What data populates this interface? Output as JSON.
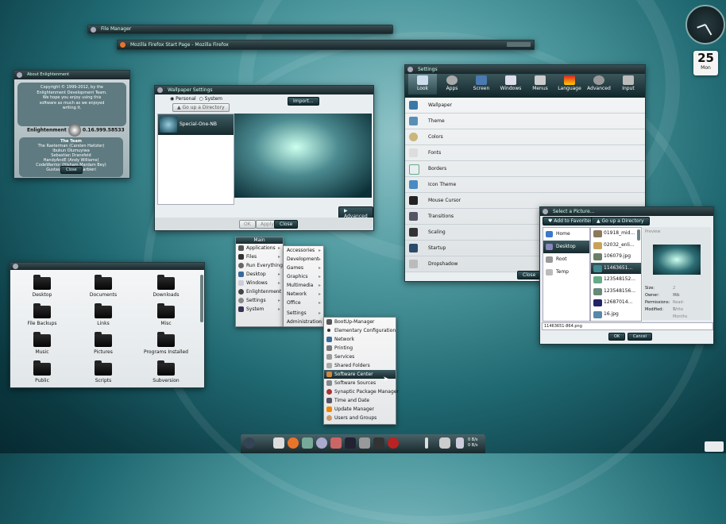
{
  "about": {
    "title": "About Enlightenment",
    "copyright": [
      "Copyright © 1999-2012, by the",
      "Enlightenment Development Team.",
      "",
      "We hope you enjoy using this",
      "software as much as we enjoyed",
      "writing it."
    ],
    "version_label": "Enlightenment",
    "version": "0.16.999.58533",
    "team_title": "The Team",
    "team": [
      "The Rasterman (Carsten Haitzler)",
      "Ibukun Olumuyiwa",
      "Sebastian Dransfeld",
      "HandyAndE (Andy Williams)",
      "CodeWarrior (Hisham Mardam Bey)",
      "Gustavo Sverzut Barbieri"
    ],
    "close_label": "Close"
  },
  "bar1": {
    "title": "File Manager"
  },
  "firefox": {
    "title": "Mozilla Firefox Start Page - Mozilla Firefox"
  },
  "wallpaper": {
    "title": "Wallpaper Settings",
    "personal": "Personal",
    "system": "System",
    "up_dir": "Go up a Directory",
    "import": "Import...",
    "item": "Special-One-NB",
    "advanced": "Advanced",
    "ok": "OK",
    "apply": "Apply",
    "close": "Close"
  },
  "settings": {
    "title": "Settings",
    "tabs": [
      "Look",
      "Apps",
      "Screen",
      "Windows",
      "Menus",
      "Language",
      "Advanced",
      "Input"
    ],
    "rows": [
      "Wallpaper",
      "Theme",
      "Colors",
      "Fonts",
      "Borders",
      "Icon Theme",
      "Mouse Cursor",
      "Transitions",
      "Scaling",
      "Startup",
      "Dropshadow"
    ],
    "close": "Close"
  },
  "filemgr": {
    "folders": [
      "Desktop",
      "Documents",
      "Downloads",
      "File Backups",
      "Links",
      "Misc",
      "Music",
      "Pictures",
      "Programs Installed",
      "Public",
      "Scripts",
      "Subversion"
    ]
  },
  "mainmenu": {
    "title": "Main",
    "items": [
      "Applications",
      "Files",
      "Run Everything",
      "Desktop",
      "Windows",
      "Enlightenment",
      "Settings",
      "System"
    ],
    "sub": [
      "Accessories",
      "Development",
      "Games",
      "Graphics",
      "Multimedia",
      "Network",
      "Office",
      "Settings",
      "Administration"
    ],
    "admin": [
      "BootUp-Manager",
      "Elementary Configuration",
      "Network",
      "Printing",
      "Services",
      "Shared Folders",
      "Software Center",
      "Software Sources",
      "Synaptic Package Manager",
      "Time and Date",
      "Update Manager",
      "Users and Groups"
    ]
  },
  "filedialog": {
    "title": "Select a Picture...",
    "fav": "Add to Favorites",
    "up": "Go up a Directory",
    "places": [
      "Home",
      "Desktop",
      "Root",
      "Temp"
    ],
    "files": [
      "01918_mid...",
      "02032_enli...",
      "106079.jpg",
      "11463651...",
      "123548152...",
      "123548156...",
      "12687014...",
      "16.jpg"
    ],
    "preview": "Preview",
    "size_k": "Size:",
    "size_v": "2 MB",
    "owner_k": "Owner:",
    "owner_v": "You",
    "perm_k": "Permissions:",
    "perm_v": "Read-Write",
    "mod_k": "Modified:",
    "mod_v": "1 Months ago",
    "filename": "11463651-864.png",
    "ok": "OK",
    "cancel": "Cancel"
  },
  "calendar": {
    "day": "25",
    "weekday": "Mon"
  },
  "taskbar": {
    "net_up": "0 B/s",
    "net_down": "0 B/s"
  }
}
